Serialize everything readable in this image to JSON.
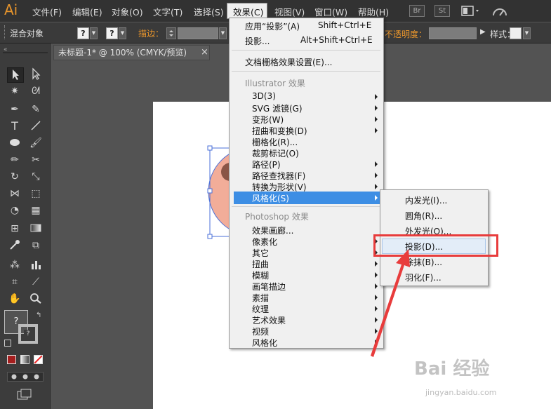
{
  "app": {
    "logo": "Ai"
  },
  "menubar": {
    "items": [
      "文件(F)",
      "编辑(E)",
      "对象(O)",
      "文字(T)",
      "选择(S)",
      "效果(C)",
      "视图(V)",
      "窗口(W)",
      "帮助(H)"
    ],
    "right_buttons": [
      "Br",
      "St"
    ]
  },
  "control_bar": {
    "mode_label": "混合对象",
    "stroke_label": "描边：",
    "opacity_label": "不透明度：",
    "style_label": "样式："
  },
  "doc_tab": {
    "title": "未标题-1* @ 100% (CMYK/预览)",
    "close": "×"
  },
  "effect_menu": {
    "apply_last": {
      "label": "应用“投影”(A)",
      "shortcut": "Shift+Ctrl+E"
    },
    "last_effect": {
      "label": "投影...",
      "shortcut": "Alt+Shift+Ctrl+E"
    },
    "doc_raster_settings": "文档栅格效果设置(E)...",
    "illustrator_header": "Illustrator 效果",
    "illustrator_items": [
      {
        "label": "3D(3)",
        "submenu": true
      },
      {
        "label": "SVG 滤镜(G)",
        "submenu": true
      },
      {
        "label": "变形(W)",
        "submenu": true
      },
      {
        "label": "扭曲和变换(D)",
        "submenu": true
      },
      {
        "label": "栅格化(R)...",
        "submenu": false
      },
      {
        "label": "裁剪标记(O)",
        "submenu": false
      },
      {
        "label": "路径(P)",
        "submenu": true
      },
      {
        "label": "路径查找器(F)",
        "submenu": true
      },
      {
        "label": "转换为形状(V)",
        "submenu": true
      },
      {
        "label": "风格化(S)",
        "submenu": true
      }
    ],
    "photoshop_header": "Photoshop 效果",
    "photoshop_items": [
      {
        "label": "效果画廊...",
        "submenu": false
      },
      {
        "label": "像素化",
        "submenu": true
      },
      {
        "label": "其它",
        "submenu": true
      },
      {
        "label": "扭曲",
        "submenu": true
      },
      {
        "label": "模糊",
        "submenu": true
      },
      {
        "label": "画笔描边",
        "submenu": true
      },
      {
        "label": "素描",
        "submenu": true
      },
      {
        "label": "纹理",
        "submenu": true
      },
      {
        "label": "艺术效果",
        "submenu": true
      },
      {
        "label": "视频",
        "submenu": true
      },
      {
        "label": "风格化",
        "submenu": true
      }
    ]
  },
  "stylize_submenu": {
    "items": [
      "内发光(I)...",
      "圆角(R)...",
      "外发光(O)...",
      "投影(D)...",
      "涂抹(B)...",
      "羽化(F)..."
    ]
  },
  "colors": {
    "accent": "#e8952c",
    "highlight": "#3d8ee4",
    "annotation": "#e83c3c"
  },
  "watermark": {
    "text": "Bai 经验",
    "url": "jingyan.baidu.com"
  }
}
